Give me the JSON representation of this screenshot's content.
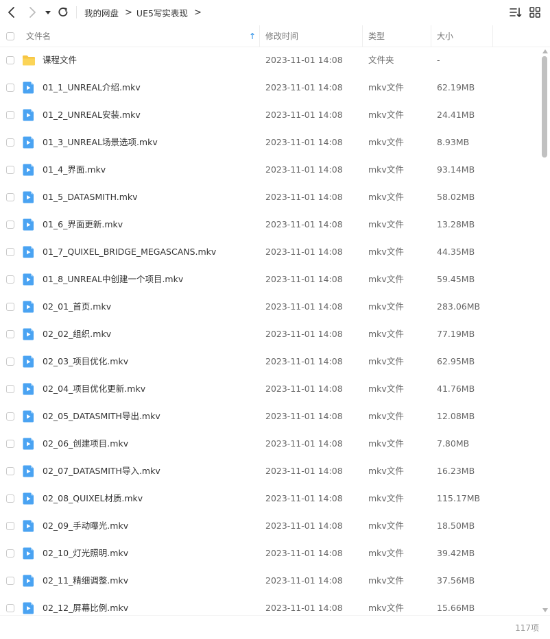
{
  "toolbar": {
    "back_icon": "chevron-left-icon",
    "forward_icon": "chevron-right-icon",
    "history_icon": "caret-down-icon",
    "refresh_icon": "refresh-icon",
    "sort_icon": "sort-list-icon",
    "view_icon": "grid-view-icon"
  },
  "breadcrumb": {
    "items": [
      "我的网盘",
      "UE5写实表现"
    ],
    "separator": ">"
  },
  "columns": {
    "name": "文件名",
    "modified": "修改时间",
    "type": "类型",
    "size": "大小",
    "sort_indicator": "↑"
  },
  "colors": {
    "accent": "#1e88e5",
    "folder": "#f7c644",
    "video": "#4aa3f2"
  },
  "files": [
    {
      "name": "课程文件",
      "modified": "2023-11-01 14:08",
      "type": "文件夹",
      "size": "-",
      "icon": "folder-icon"
    },
    {
      "name": "01_1_UNREAL介绍.mkv",
      "modified": "2023-11-01 14:08",
      "type": "mkv文件",
      "size": "62.19MB",
      "icon": "video-file-icon"
    },
    {
      "name": "01_2_UNREAL安装.mkv",
      "modified": "2023-11-01 14:08",
      "type": "mkv文件",
      "size": "24.41MB",
      "icon": "video-file-icon"
    },
    {
      "name": "01_3_UNREAL场景选项.mkv",
      "modified": "2023-11-01 14:08",
      "type": "mkv文件",
      "size": "8.93MB",
      "icon": "video-file-icon"
    },
    {
      "name": "01_4_界面.mkv",
      "modified": "2023-11-01 14:08",
      "type": "mkv文件",
      "size": "93.14MB",
      "icon": "video-file-icon"
    },
    {
      "name": "01_5_DATASMITH.mkv",
      "modified": "2023-11-01 14:08",
      "type": "mkv文件",
      "size": "58.02MB",
      "icon": "video-file-icon"
    },
    {
      "name": "01_6_界面更新.mkv",
      "modified": "2023-11-01 14:08",
      "type": "mkv文件",
      "size": "13.28MB",
      "icon": "video-file-icon"
    },
    {
      "name": "01_7_QUIXEL_BRIDGE_MEGASCANS.mkv",
      "modified": "2023-11-01 14:08",
      "type": "mkv文件",
      "size": "44.35MB",
      "icon": "video-file-icon"
    },
    {
      "name": "01_8_UNREAL中创建一个项目.mkv",
      "modified": "2023-11-01 14:08",
      "type": "mkv文件",
      "size": "59.45MB",
      "icon": "video-file-icon"
    },
    {
      "name": "02_01_首页.mkv",
      "modified": "2023-11-01 14:08",
      "type": "mkv文件",
      "size": "283.06MB",
      "icon": "video-file-icon"
    },
    {
      "name": "02_02_组织.mkv",
      "modified": "2023-11-01 14:08",
      "type": "mkv文件",
      "size": "77.19MB",
      "icon": "video-file-icon"
    },
    {
      "name": "02_03_项目优化.mkv",
      "modified": "2023-11-01 14:08",
      "type": "mkv文件",
      "size": "62.95MB",
      "icon": "video-file-icon"
    },
    {
      "name": "02_04_项目优化更新.mkv",
      "modified": "2023-11-01 14:08",
      "type": "mkv文件",
      "size": "41.76MB",
      "icon": "video-file-icon"
    },
    {
      "name": "02_05_DATASMITH导出.mkv",
      "modified": "2023-11-01 14:08",
      "type": "mkv文件",
      "size": "12.08MB",
      "icon": "video-file-icon"
    },
    {
      "name": "02_06_创建项目.mkv",
      "modified": "2023-11-01 14:08",
      "type": "mkv文件",
      "size": "7.80MB",
      "icon": "video-file-icon"
    },
    {
      "name": "02_07_DATASMITH导入.mkv",
      "modified": "2023-11-01 14:08",
      "type": "mkv文件",
      "size": "16.23MB",
      "icon": "video-file-icon"
    },
    {
      "name": "02_08_QUIXEL材质.mkv",
      "modified": "2023-11-01 14:08",
      "type": "mkv文件",
      "size": "115.17MB",
      "icon": "video-file-icon"
    },
    {
      "name": "02_09_手动曝光.mkv",
      "modified": "2023-11-01 14:08",
      "type": "mkv文件",
      "size": "18.50MB",
      "icon": "video-file-icon"
    },
    {
      "name": "02_10_灯光照明.mkv",
      "modified": "2023-11-01 14:08",
      "type": "mkv文件",
      "size": "39.42MB",
      "icon": "video-file-icon"
    },
    {
      "name": "02_11_精细调整.mkv",
      "modified": "2023-11-01 14:08",
      "type": "mkv文件",
      "size": "37.56MB",
      "icon": "video-file-icon"
    },
    {
      "name": "02_12_屏幕比例.mkv",
      "modified": "2023-11-01 14:08",
      "type": "mkv文件",
      "size": "15.66MB",
      "icon": "video-file-icon"
    }
  ],
  "footer": {
    "count": "117项"
  }
}
